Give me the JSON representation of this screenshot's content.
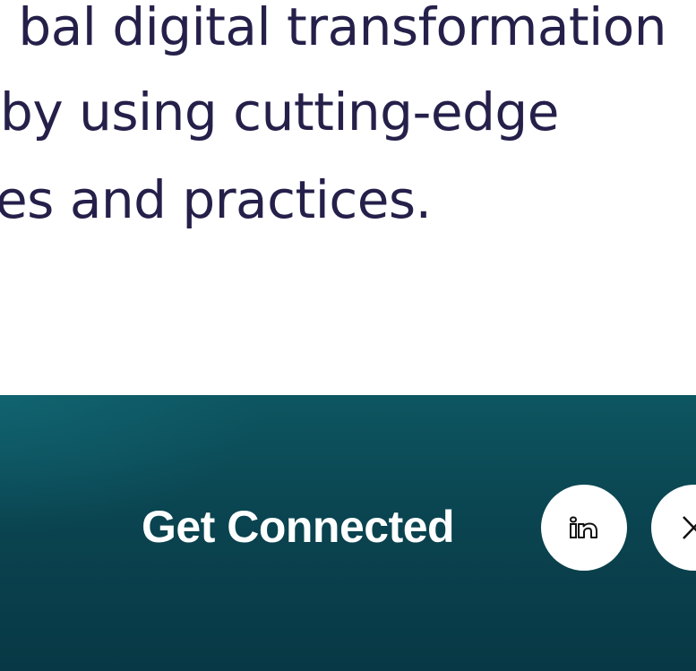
{
  "hero": {
    "lines": [
      "bal digital transformation",
      "by using cutting-edge",
      "es and practices."
    ]
  },
  "footer": {
    "connect_title": "Get Connected",
    "social": [
      {
        "icon": "linkedin-icon"
      },
      {
        "icon": "x-icon"
      }
    ]
  },
  "colors": {
    "text_dark": "#25204a",
    "band_top": "#0d5661",
    "band_bottom": "#083845",
    "white": "#ffffff"
  }
}
